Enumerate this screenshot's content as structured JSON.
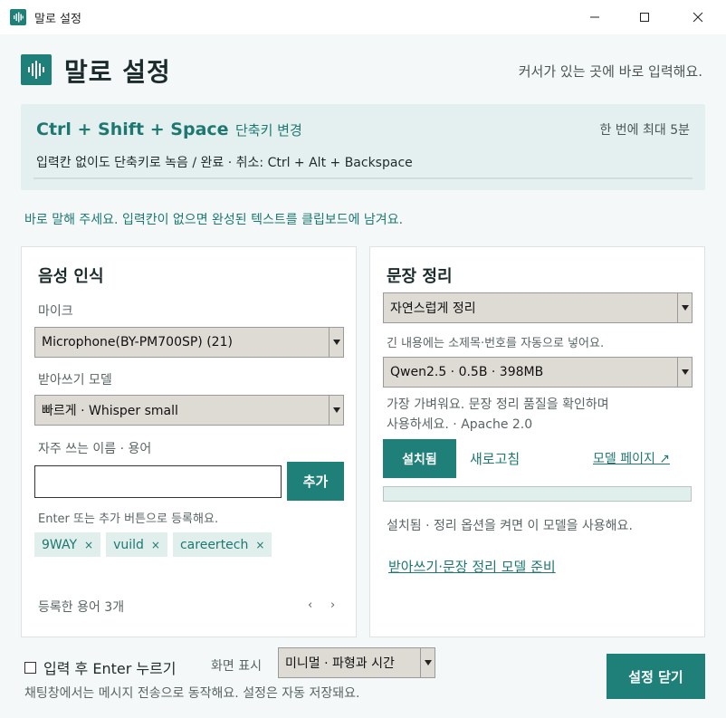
{
  "window": {
    "title": "말로 설정",
    "minimize_icon": "minimize-icon",
    "maximize_icon": "maximize-icon",
    "close_icon": "close-icon"
  },
  "header": {
    "title": "말로 설정",
    "hint": "커서가 있는 곳에 바로 입력해요.",
    "logo_icon": "waveform-icon"
  },
  "shortcut": {
    "combo": "Ctrl + Shift + Space",
    "change_label": "단축키 변경",
    "limit": "한 번에 최대 5분",
    "description": "입력칸 없이도 단축키로 녹음 / 완료  ·  취소: Ctrl + Alt + Backspace"
  },
  "info_line": "바로 말해 주세요. 입력칸이 없으면 완성된 텍스트를 클립보드에 남겨요.",
  "speech_panel": {
    "title": "음성 인식",
    "mic_label": "마이크",
    "mic_value": "Microphone(BY-PM700SP) (21)",
    "model_label": "받아쓰기 모델",
    "model_value": "빠르게 · Whisper small",
    "terms_label": "자주 쓰는 이름 · 용어",
    "terms_input_value": "",
    "add_button": "추가",
    "terms_hint": "Enter 또는 추가 버튼으로 등록해요.",
    "chips": [
      "9WAY",
      "vuild",
      "careertech"
    ],
    "chip_remove": "×",
    "count": "등록한 용어 3개",
    "prev": "‹",
    "next": "›"
  },
  "sentence_panel": {
    "title": "문장 정리",
    "mode_value": "자연스럽게 정리",
    "mode_hint": "긴 내용에는 소제목·번호를 자동으로 넣어요.",
    "model_value": "Qwen2.5 · 0.5B · 398MB",
    "model_desc_line1": "가장 가벼워요. 문장 정리 품질을 확인하며",
    "model_desc_line2": "사용하세요. · Apache 2.0",
    "installed_button": "설치됨",
    "refresh_label": "새로고침",
    "model_page_label": "모델 페이지 ↗",
    "progress": 0,
    "status": "설치됨 · 정리 옵션을 켜면 이 모델을 사용해요.",
    "prepare_link": "받아쓰기·문장 정리 모델 준비"
  },
  "footer": {
    "enter_label": "입력 후 Enter 누르기",
    "enter_checked": false,
    "display_label": "화면 표시",
    "display_value": "미니멀 · 파형과 시간",
    "note": "채팅창에서는 메시지 전송으로 동작해요. 설정은 자동 저장돼요.",
    "close_button": "설정 닫기"
  },
  "colors": {
    "accent": "#1e8079",
    "accent_light": "#e0eeec",
    "background": "#f4f8f8"
  }
}
